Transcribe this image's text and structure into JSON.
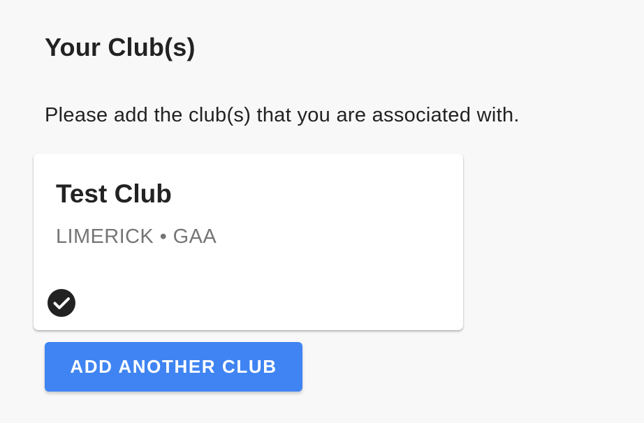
{
  "section": {
    "title": "Your Club(s)",
    "instructions": "Please add the club(s) that you are associated with."
  },
  "clubs": [
    {
      "name": "Test Club",
      "meta": "LIMERICK • GAA",
      "status_icon": "check-circle-icon"
    }
  ],
  "actions": {
    "add_club_label": "ADD ANOTHER CLUB"
  },
  "colors": {
    "background": "#f8f8f8",
    "primary_button": "#3f84f2",
    "text": "#222222",
    "muted_text": "#757575"
  }
}
